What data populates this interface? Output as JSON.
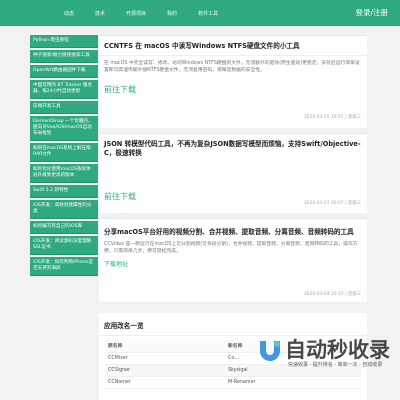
{
  "header": {
    "nav": [
      "动态",
      "技术",
      "开源项目",
      "我的",
      "软件工具"
    ],
    "login": "登录/注册",
    "background": "#2fa97e"
  },
  "sidebar": {
    "items": [
      "Python 爬虫教程",
      "种子搜索/磁力链接搜索工具",
      "OpenWrt路由器固件下载",
      "中国可用的 BT Tracker 服务器，每24小时自动更新",
      "前端开发工具",
      "ElementSnap 一个优雅的，面向对Vue/iOS/macOS自动布局框架",
      "如何在macOS系统上解压缩RAR文件",
      "如何优化使用macOS系统体验升级到更高的版本",
      "Swift 5.2 新特性",
      "iOS开发：高效创建属性的分类",
      "如何编写有自己的iOS库",
      "iOS开发：阅读源码深度理解SSL证书",
      "iOS开发：如何判断iPhone是否支持刘海屏"
    ]
  },
  "posts": [
    {
      "title": "CCNTFS 在 macOS 中读写Windows NTFS硬盘文件的小工具",
      "desc": "在 macOS 中完全读写、修改、访问Windows NTFS硬盘的文件，无须额外的驱动(原生驱动)更稳定，安装后运行简单设置即可高速传输外接NTFS硬盘文件，无须复用密码，保障您数据的安全性。",
      "link": "前往下载",
      "meta": "2020-03-25 16:57 / 黑狐三"
    },
    {
      "title": "JSON 转模型代码工具，不再为复杂JSON数据写模型而烦恼，支持Swift/Objective-C，极速转换",
      "desc": "",
      "link": "前往下载",
      "meta": "2020-03-07 00:07 / 黑狐三"
    },
    {
      "title": "分享macOS平台好用的视频分割、合并视频、提取音频、分离音频、音频转码的工具",
      "desc": "CCVideo 是一款运行在macOS上可分割视频(可多段分割)，合并视频，提取音频，分离音频，音频转码的工具，操作方便，只需简单几步，便可轻松完成。",
      "link": "下载地址",
      "meta": "2020-03-04 20:27 / 黑狐三"
    }
  ],
  "rename_table": {
    "title": "应用改名一览",
    "headers": [
      "原名称",
      "新名称"
    ],
    "rows": [
      [
        "CCMixer",
        "Co..."
      ],
      [
        "CCSigner",
        "Skysigal"
      ],
      [
        "CCNamer",
        "M-Renamer"
      ]
    ]
  },
  "watermark": {
    "text": "自动秒收录",
    "sub": "快速收录 · 提升排名 · 简单一次 · 自动收录"
  }
}
